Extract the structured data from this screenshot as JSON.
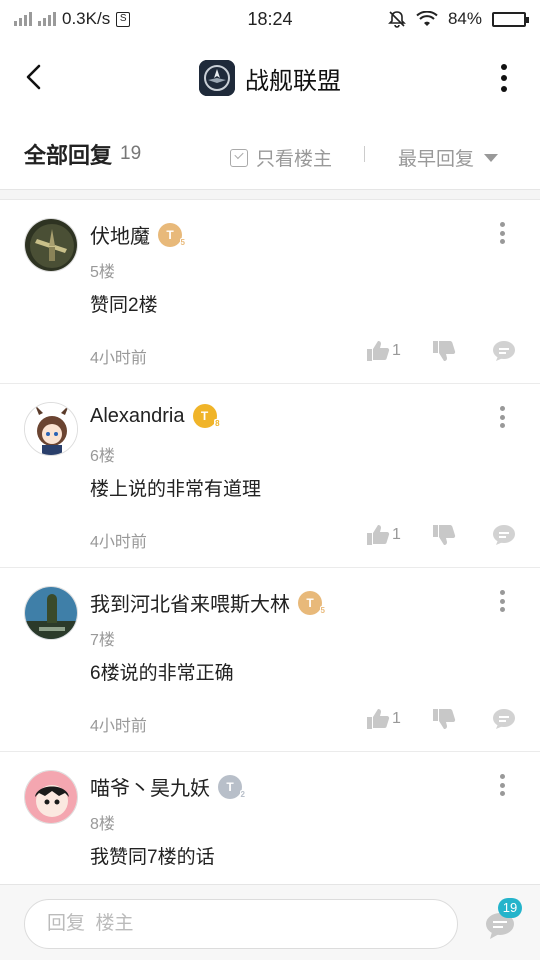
{
  "status_bar": {
    "network_speed": "0.3K/s",
    "time": "18:24",
    "battery": "84%",
    "battery_level": 0.84
  },
  "header": {
    "title": "战舰联盟"
  },
  "filter": {
    "title": "全部回复",
    "count": "19",
    "only_op_label": "只看楼主",
    "sort_label": "最早回复"
  },
  "replies": [
    {
      "username": "伏地魔",
      "badge": "T",
      "badge_level": "5",
      "badge_color": "#e8b97a",
      "floor": "5楼",
      "content": "赞同2楼",
      "time": "4小时前",
      "likes": "1"
    },
    {
      "username": "Alexandria",
      "badge": "T",
      "badge_level": "8",
      "badge_color": "#f0b429",
      "floor": "6楼",
      "content": "楼上说的非常有道理",
      "time": "4小时前",
      "likes": "1"
    },
    {
      "username": "我到河北省来喂斯大林",
      "badge": "T",
      "badge_level": "5",
      "badge_color": "#e8b97a",
      "floor": "7楼",
      "content": "6楼说的非常正确",
      "time": "4小时前",
      "likes": "1"
    },
    {
      "username": "喵爷丶昊九妖",
      "badge": "T",
      "badge_level": "2",
      "badge_color": "#b8bfc9",
      "floor": "8楼",
      "content": "我赞同7楼的话",
      "time": "",
      "likes": ""
    }
  ],
  "bottom": {
    "input_placeholder": "回复  楼主",
    "comment_count": "19"
  },
  "colors": {
    "accent": "#25b4cb",
    "muted": "#999999"
  }
}
